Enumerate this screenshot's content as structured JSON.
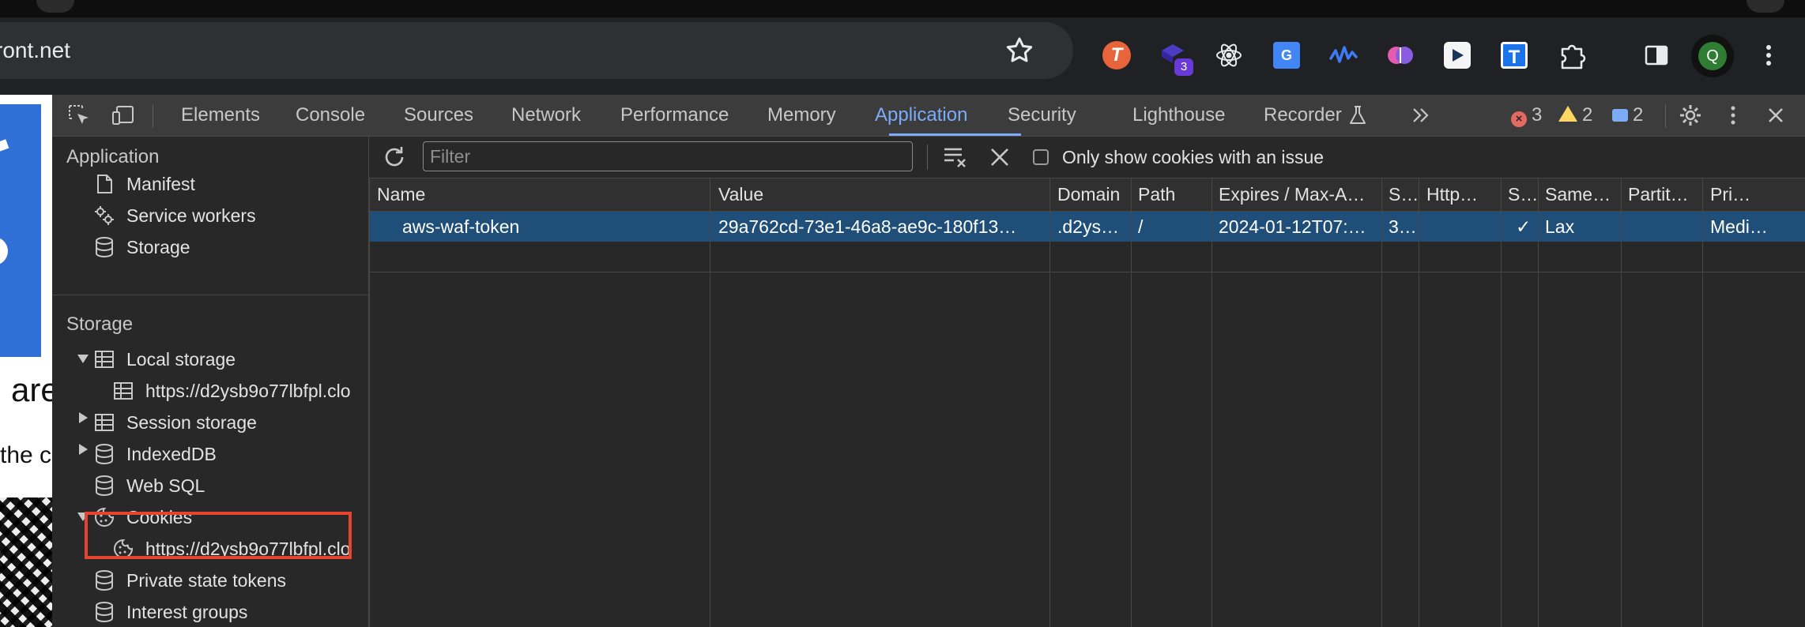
{
  "browser": {
    "url_fragment": "lfront.net",
    "extension_badge": "3",
    "avatar_letter": "Q"
  },
  "page": {
    "fragment_large": "are",
    "fragment_small": "the c"
  },
  "devtools": {
    "tabs": [
      "Elements",
      "Console",
      "Sources",
      "Network",
      "Performance",
      "Memory",
      "Application",
      "Security",
      "Lighthouse",
      "Recorder"
    ],
    "active_tab": "Application",
    "errors": "3",
    "warnings": "2",
    "messages": "2"
  },
  "sidebar": {
    "application_header": "Application",
    "application_items": [
      "Manifest",
      "Service workers",
      "Storage"
    ],
    "storage_header": "Storage",
    "local_storage": "Local storage",
    "local_storage_origin": "https://d2ysb9o77lbfpl.clo",
    "session_storage": "Session storage",
    "indexeddb": "IndexedDB",
    "web_sql": "Web SQL",
    "cookies": "Cookies",
    "cookies_origin": "https://d2ysb9o77lbfpl.clo",
    "private_state_tokens": "Private state tokens",
    "interest_groups": "Interest groups"
  },
  "filter": {
    "placeholder": "Filter",
    "only_issue_label": "Only show cookies with an issue"
  },
  "table": {
    "headers": [
      "Name",
      "Value",
      "Domain",
      "Path",
      "Expires / Max-A…",
      "S…",
      "Http…",
      "S…",
      "Same…",
      "Partit…",
      "Pri…"
    ],
    "rows": [
      [
        "aws-waf-token",
        "29a762cd-73e1-46a8-ae9c-180f13…",
        ".d2ys…",
        "/",
        "2024-01-12T07:…",
        "3…",
        "",
        "✓",
        "Lax",
        "",
        "Medi…"
      ]
    ]
  },
  "colors": {
    "accent": "#7cacf8",
    "selected_row": "#1f4e79",
    "highlight_box": "#e5452e"
  }
}
